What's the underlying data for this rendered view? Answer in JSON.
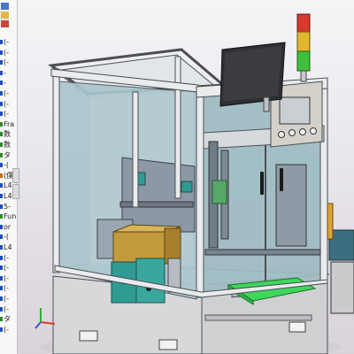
{
  "feature_tree": {
    "top_icons": [
      {
        "name": "document-icon",
        "color": "#4a76c6"
      },
      {
        "name": "folder-icon",
        "color": "#e0b84a"
      },
      {
        "name": "chart-icon",
        "color": "#c9463d"
      }
    ],
    "items": [
      {
        "text": "(-",
        "color": "#1e4db7"
      },
      {
        "text": "(-",
        "color": "#1e4db7"
      },
      {
        "text": "(-",
        "color": "#1e4db7"
      },
      {
        "text": "-",
        "color": "#1e4db7"
      },
      {
        "text": "-",
        "color": "#1e4db7"
      },
      {
        "text": "(-",
        "color": "#1e4db7"
      },
      {
        "text": "(-",
        "color": "#1e4db7"
      },
      {
        "text": "(-",
        "color": "#1e4db7"
      },
      {
        "text": "Fra",
        "color": "#2a8a2a"
      },
      {
        "text": "数",
        "color": "#2a8a2a"
      },
      {
        "text": "数",
        "color": "#2a8a2a"
      },
      {
        "text": "タ",
        "color": "#2a8a2a"
      },
      {
        "text": "-(",
        "color": "#1e4db7"
      },
      {
        "text": "(僕",
        "color": "#c96a1c"
      },
      {
        "text": "L4",
        "color": "#1e4db7"
      },
      {
        "text": "L4",
        "color": "#1e4db7"
      },
      {
        "text": "5-",
        "color": "#1e4db7"
      },
      {
        "text": "Fun",
        "color": "#2a8a2a"
      },
      {
        "text": "or",
        "color": "#1e4db7"
      },
      {
        "text": "-(",
        "color": "#1e4db7"
      },
      {
        "text": "L4",
        "color": "#1e4db7"
      },
      {
        "text": "(-",
        "color": "#1e4db7"
      },
      {
        "text": "(-",
        "color": "#1e4db7"
      },
      {
        "text": "(-",
        "color": "#1e4db7"
      },
      {
        "text": "(-",
        "color": "#1e4db7"
      },
      {
        "text": "(-",
        "color": "#1e4db7"
      },
      {
        "text": "(-",
        "color": "#1e4db7"
      },
      {
        "text": "タ",
        "color": "#2a8a2a"
      },
      {
        "text": "(-",
        "color": "#1e4db7"
      }
    ]
  },
  "colors": {
    "frame": "#e9ebec",
    "frame_edge": "#4b4f55",
    "glass": "#a9c4cd",
    "glass_door": "#9dbcc2",
    "machine_plate": "#8a96a3",
    "teal_block": "#2f9b93",
    "gold_block": "#c29a3c",
    "green_tray": "#3fd65c",
    "lamp_red": "#d83a2b",
    "lamp_yellow": "#e2b62c",
    "lamp_green": "#3fbf3a",
    "screen": "#2f3033",
    "base": "#d3d4d6"
  },
  "triad": {
    "x_color": "#d83a2b",
    "y_color": "#2fb12f",
    "z_color": "#3457d5"
  }
}
